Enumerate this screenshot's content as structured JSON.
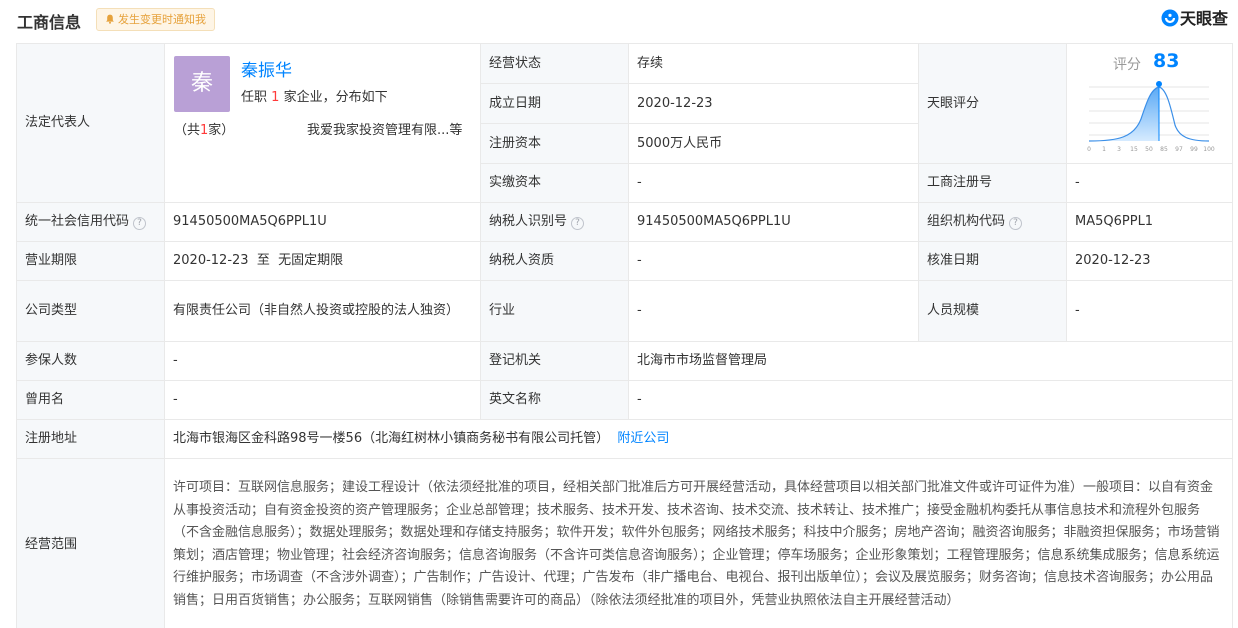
{
  "header": {
    "title": "工商信息",
    "notify_label": "发生变更时通知我",
    "brand_name": "天眼查"
  },
  "legal_rep": {
    "label": "法定代表人",
    "avatar_char": "秦",
    "name": "秦振华",
    "sub_prefix": "任职",
    "sub_count": "1",
    "sub_suffix": "家企业，分布如下",
    "count_prefix": "（共",
    "count_num": "1",
    "count_suffix": "家）",
    "company": "我爱我家投资管理有限...等"
  },
  "rows": {
    "status_label": "经营状态",
    "status_value": "存续",
    "founded_label": "成立日期",
    "founded_value": "2020-12-23",
    "reg_capital_label": "注册资本",
    "reg_capital_value": "5000万人民币",
    "paid_capital_label": "实缴资本",
    "paid_capital_value": "-",
    "tianyan_score_label": "天眼评分",
    "biz_reg_no_label": "工商注册号",
    "biz_reg_no_value": "-",
    "credit_code_label": "统一社会信用代码",
    "credit_code_value": "91450500MA5Q6PPL1U",
    "taxpayer_id_label": "纳税人识别号",
    "taxpayer_id_value": "91450500MA5Q6PPL1U",
    "org_code_label": "组织机构代码",
    "org_code_value": "MA5Q6PPL1",
    "term_label": "营业期限",
    "term_value": "2020-12-23  至  无固定期限",
    "taxpayer_qual_label": "纳税人资质",
    "taxpayer_qual_value": "-",
    "approval_date_label": "核准日期",
    "approval_date_value": "2020-12-23",
    "company_type_label": "公司类型",
    "company_type_value": "有限责任公司（非自然人投资或控股的法人独资）",
    "industry_label": "行业",
    "industry_value": "-",
    "staff_size_label": "人员规模",
    "staff_size_value": "-",
    "insured_label": "参保人数",
    "insured_value": "-",
    "reg_authority_label": "登记机关",
    "reg_authority_value": "北海市市场监督管理局",
    "former_name_label": "曾用名",
    "former_name_value": "-",
    "english_name_label": "英文名称",
    "english_name_value": "-",
    "address_label": "注册地址",
    "address_value": "北海市银海区金科路98号一楼56（北海红树林小镇商务秘书有限公司托管）",
    "nearby_link": "附近公司",
    "scope_label": "经营范围",
    "scope_value": "许可项目：互联网信息服务；建设工程设计（依法须经批准的项目，经相关部门批准后方可开展经营活动，具体经营项目以相关部门批准文件或许可证件为准）一般项目：以自有资金从事投资活动；自有资金投资的资产管理服务；企业总部管理；技术服务、技术开发、技术咨询、技术交流、技术转让、技术推广；接受金融机构委托从事信息技术和流程外包服务（不含金融信息服务）；数据处理服务；数据处理和存储支持服务；软件开发；软件外包服务；网络技术服务；科技中介服务；房地产咨询；融资咨询服务；非融资担保服务；市场营销策划；酒店管理；物业管理；社会经济咨询服务；信息咨询服务（不含许可类信息咨询服务）；企业管理；停车场服务；企业形象策划；工程管理服务；信息系统集成服务；信息系统运行维护服务；市场调查（不含涉外调查）；广告制作；广告设计、代理；广告发布（非广播电台、电视台、报刊出版单位）；会议及展览服务；财务咨询；信息技术咨询服务；办公用品销售；日用百货销售；办公服务；互联网销售（除销售需要许可的商品）（除依法须经批准的项目外，凭营业执照依法自主开展经营活动）"
  },
  "score": {
    "label": "评分",
    "value": "83",
    "value_num": 83,
    "ticks": [
      "0",
      "1",
      "3",
      "15",
      "50",
      "85",
      "97",
      "99",
      "100"
    ],
    "accent_color": "#0084ff"
  }
}
